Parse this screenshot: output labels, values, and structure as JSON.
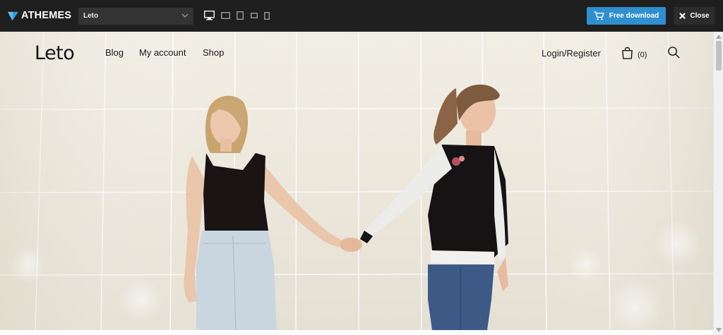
{
  "topbar": {
    "brand": "ATHEMES",
    "theme_select": {
      "value": "Leto"
    },
    "devices": [
      "desktop-icon",
      "laptop-icon",
      "tablet-portrait-icon",
      "tablet-landscape-icon",
      "phone-icon"
    ],
    "download_label": "Free download",
    "close_label": "Close",
    "accent_color": "#2f8fcf"
  },
  "site": {
    "logo": "Leto",
    "nav": [
      {
        "label": "Blog"
      },
      {
        "label": "My account"
      },
      {
        "label": "Shop"
      }
    ],
    "login_label": "Login/Register",
    "cart_count": "(0)",
    "hero_alt": "Two women holding hands in front of a tiled wall"
  }
}
